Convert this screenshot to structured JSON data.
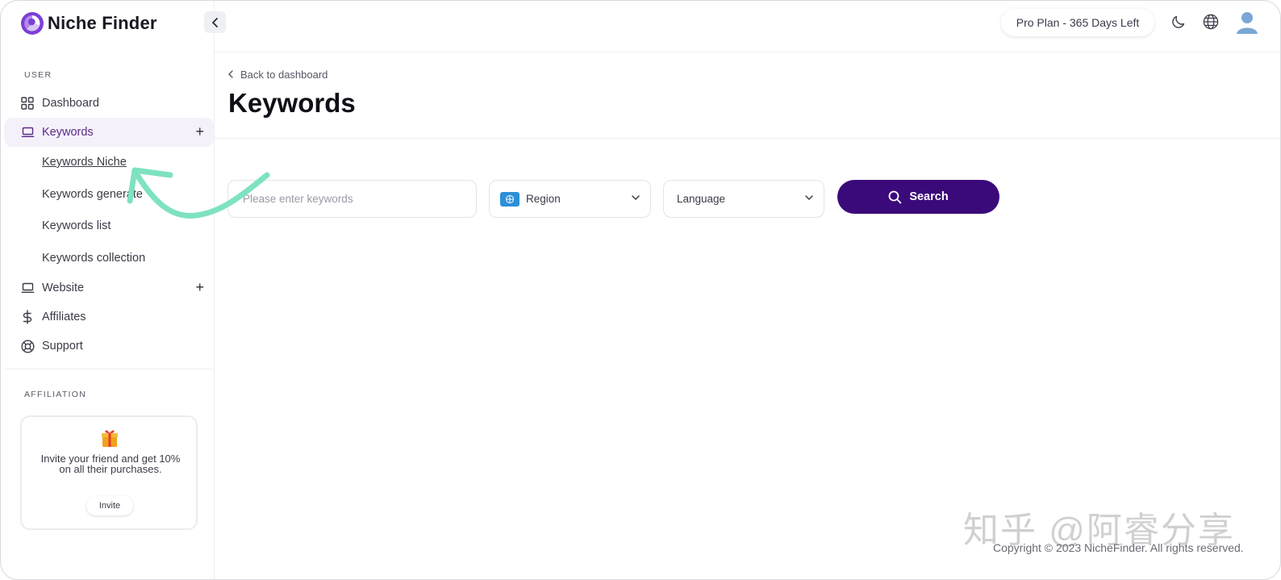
{
  "app": {
    "name": "Niche Finder"
  },
  "sidebar": {
    "user_section_label": "USER",
    "affiliation_section_label": "AFFILIATION",
    "items": [
      {
        "label": "Dashboard",
        "icon": "grid-icon"
      },
      {
        "label": "Keywords",
        "icon": "laptop-icon",
        "active": true,
        "expandable": true
      },
      {
        "label": "Website",
        "icon": "laptop-icon",
        "expandable": true
      },
      {
        "label": "Affiliates",
        "icon": "dollar-icon"
      },
      {
        "label": "Support",
        "icon": "lifebuoy-icon"
      }
    ],
    "keywords_subitems": [
      {
        "label": "Keywords Niche",
        "current": true
      },
      {
        "label": "Keywords generate"
      },
      {
        "label": "Keywords list"
      },
      {
        "label": "Keywords collection"
      }
    ],
    "expand_symbol": "+",
    "invite_card": {
      "text": "Invite your friend and get 10% on all their purchases.",
      "button_label": "Invite",
      "icon": "gift-icon"
    }
  },
  "topbar": {
    "plan_badge": "Pro Plan - 365 Days Left",
    "icons": [
      "moon-icon",
      "globe-icon",
      "user-avatar-icon"
    ]
  },
  "main": {
    "back_link": "Back to dashboard",
    "title": "Keywords",
    "search": {
      "keyword_placeholder": "Please enter keywords",
      "region_label": "Region",
      "language_label": "Language",
      "button_label": "Search"
    }
  },
  "footer": {
    "copyright": "Copyright © 2023 NicheFinder. All rights reserved.",
    "watermark": "知乎 @阿睿分享"
  },
  "colors": {
    "primary": "#3b0a7a",
    "active_nav_bg": "#f5f1fa",
    "active_nav_text": "#5b2a8a",
    "annotation_arrow": "#7ee2c0"
  }
}
